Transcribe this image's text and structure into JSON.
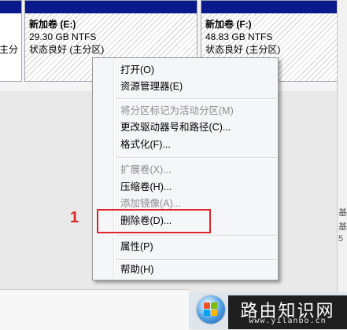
{
  "partitions": {
    "left_fragment": {
      "line": "主分"
    },
    "e": {
      "title": "新加卷  (E:)",
      "size": "29.30 GB NTFS",
      "status": "状态良好 (主分区)"
    },
    "f": {
      "title": "新加卷  (F:)",
      "size": "48.83 GB NTFS",
      "status": "状态良好 (主分区)"
    }
  },
  "context_menu": {
    "items": [
      {
        "label": "打开(O)",
        "enabled": true
      },
      {
        "label": "资源管理器(E)",
        "enabled": true
      },
      {
        "label": "将分区标记为活动分区(M)",
        "enabled": false
      },
      {
        "label": "更改驱动器号和路径(C)...",
        "enabled": true
      },
      {
        "label": "格式化(F)...",
        "enabled": true
      },
      {
        "label": "扩展卷(X)...",
        "enabled": false
      },
      {
        "label": "压缩卷(H)...",
        "enabled": true
      },
      {
        "label": "添加镜像(A)...",
        "enabled": false
      },
      {
        "label": "删除卷(D)...",
        "enabled": true
      },
      {
        "label": "属性(P)",
        "enabled": true
      },
      {
        "label": "帮助(H)",
        "enabled": true
      }
    ]
  },
  "annotation": {
    "step": "1",
    "color": "#e0252a"
  },
  "right_edge": {
    "glyphs": [
      "基",
      "基",
      "5"
    ]
  },
  "watermark": {
    "title": "路由知识网",
    "url": "www.yilanbo.cn"
  },
  "colors": {
    "partition_bar": "#0b1a8a",
    "menu_bg": "#f5f6f8"
  },
  "icons": [
    "windows-start-orb-icon"
  ]
}
